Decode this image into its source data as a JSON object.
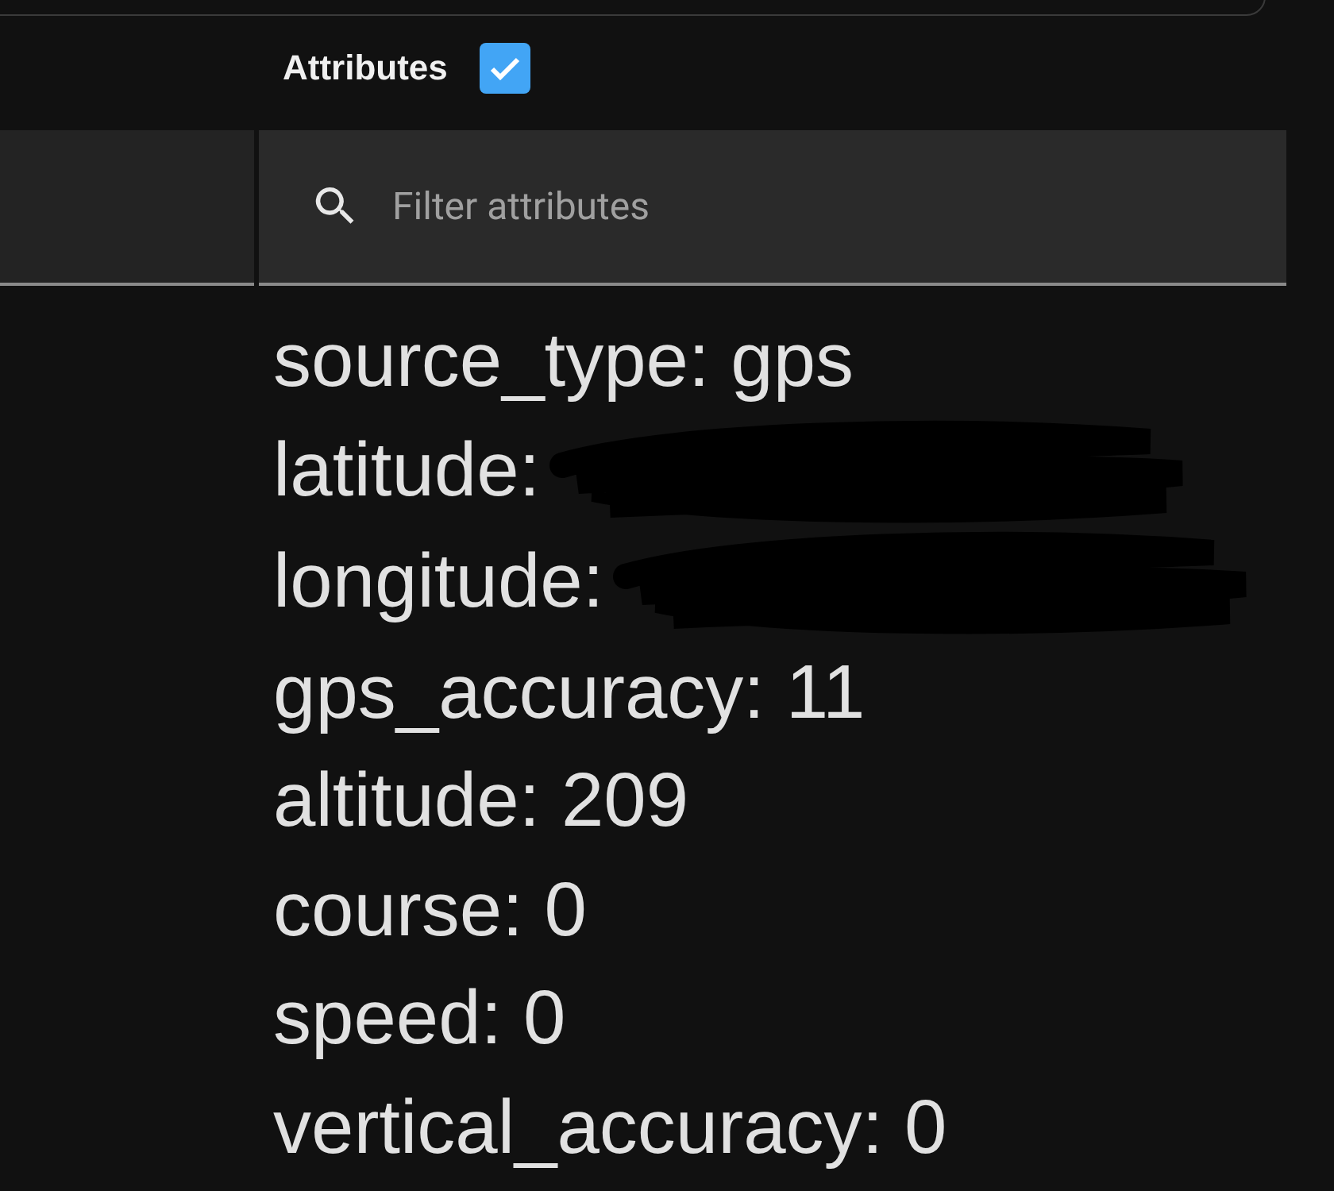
{
  "attributes_toggle": {
    "label": "Attributes",
    "checked": true
  },
  "filter": {
    "placeholder": "Filter attributes"
  },
  "attributes": [
    {
      "text": "source_type: gps",
      "redacted": false
    },
    {
      "text": "latitude:",
      "redacted": true
    },
    {
      "text": "longitude:",
      "redacted": true
    },
    {
      "text": "gps_accuracy: 11",
      "redacted": false
    },
    {
      "text": "altitude: 209",
      "redacted": false
    },
    {
      "text": "course: 0",
      "redacted": false
    },
    {
      "text": "speed: 0",
      "redacted": false
    },
    {
      "text": "vertical_accuracy: 0",
      "redacted": false
    }
  ]
}
